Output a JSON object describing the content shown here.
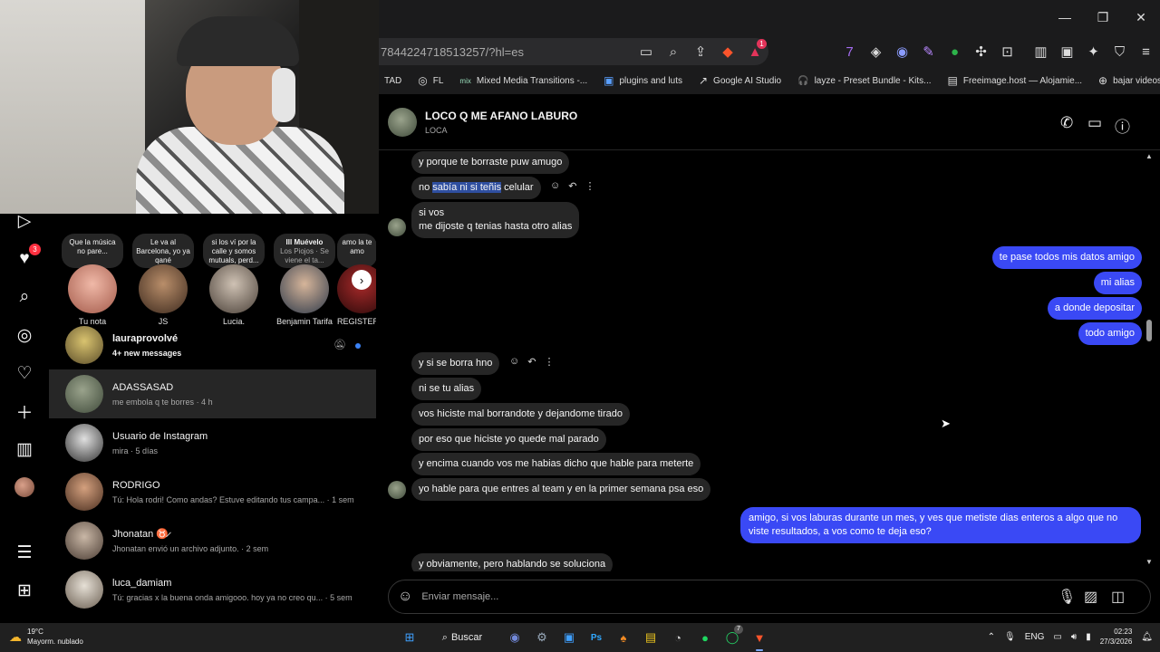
{
  "browser": {
    "url": "7844224718513257/?hl=es",
    "bookmarks": [
      {
        "icon": "",
        "label": "TAD"
      },
      {
        "icon": "◎",
        "label": "FL"
      },
      {
        "icon": "mix",
        "label": "Mixed Media Transitions -..."
      },
      {
        "icon": "▣",
        "label": "plugins and luts"
      },
      {
        "icon": "↗",
        "label": "Google AI Studio"
      },
      {
        "icon": "🎧",
        "label": "layze - Preset Bundle - Kits..."
      },
      {
        "icon": "▤",
        "label": "Freeimage.host — Alojamie..."
      },
      {
        "icon": "⊕",
        "label": "bajar videos"
      }
    ],
    "alerts_badge": "1"
  },
  "nav": {
    "notifications_badge": "3"
  },
  "notes": {
    "items": [
      {
        "text": "Que la música no pare...",
        "sub": "",
        "name": "Tu nota"
      },
      {
        "text": "Le va al Barcelona, yo ya qané",
        "sub": "",
        "name": "JS"
      },
      {
        "text": "si los ví por la calle y somos mutuals, perd...",
        "sub": "",
        "name": "Lucia."
      },
      {
        "text": "Ill Muévelo",
        "sub": "Los Piojos · Se viene el ta...",
        "name": "Benjamin Tarifa"
      },
      {
        "text": "amo la te amo",
        "sub": "",
        "name": "REGISTER"
      }
    ]
  },
  "threads": [
    {
      "name": "lauraprovolvé",
      "preview": "4+ new messages",
      "time": ""
    },
    {
      "name": "ADASSASAD",
      "preview": "me embola q te borres",
      "time": "· 4 h"
    },
    {
      "name": "Usuario de Instagram",
      "preview": "mira",
      "time": "· 5 días"
    },
    {
      "name": "RODRIGO",
      "preview": "Tú: Hola rodri! Como andas? Estuve editando tus campa...",
      "time": "· 1 sem"
    },
    {
      "name": "Jhonatan ♉̷",
      "preview": "Jhonatan envió un archivo adjunto.",
      "time": "· 2 sem"
    },
    {
      "name": "luca_damiam",
      "preview": "Tú: gracias x la buena onda amigooo. hoy ya no creo qu...",
      "time": "· 5 sem"
    }
  ],
  "chat": {
    "title": "LOCO Q ME AFANO LABURO",
    "subtitle": "LOCA",
    "messages": {
      "m1": "y porque te borraste puw amugo",
      "m2_pre": "no ",
      "m2_hl": "sabía ni si teñis",
      "m2_post": " celular",
      "m3a": "si vos",
      "m3b": "me dijoste q tenias hasta otro alias",
      "o1": "te pase todos mis datos amigo",
      "o2": "mi alias",
      "o3": "a donde depositar",
      "o4": "todo amigo",
      "m4": "y si se borra hno",
      "m5": "ni se tu alias",
      "m6": "vos hiciste mal borrandote y dejandome tirado",
      "m7": "por eso que hiciste yo quede mal parado",
      "m8": "y encima cuando vos me habias dicho que hable para meterte",
      "m9": "yo hable para que entres al team y en la primer semana psa eso",
      "o5a": "amigo, si vos laburas durante un mes, y ves que metiste dias enteros a algo que no",
      "o5b": "viste resultados, a vos como te deja eso?",
      "m10": "y obviamente, pero hablando se soluciona"
    },
    "composer_placeholder": "Enviar mensaje..."
  },
  "taskbar": {
    "temp": "19°C",
    "weather": "Mayorm. nublado",
    "search": "Buscar",
    "whatsapp_badge": "7",
    "lang": "ENG",
    "time": "02:23",
    "date": "27/3/2026"
  }
}
